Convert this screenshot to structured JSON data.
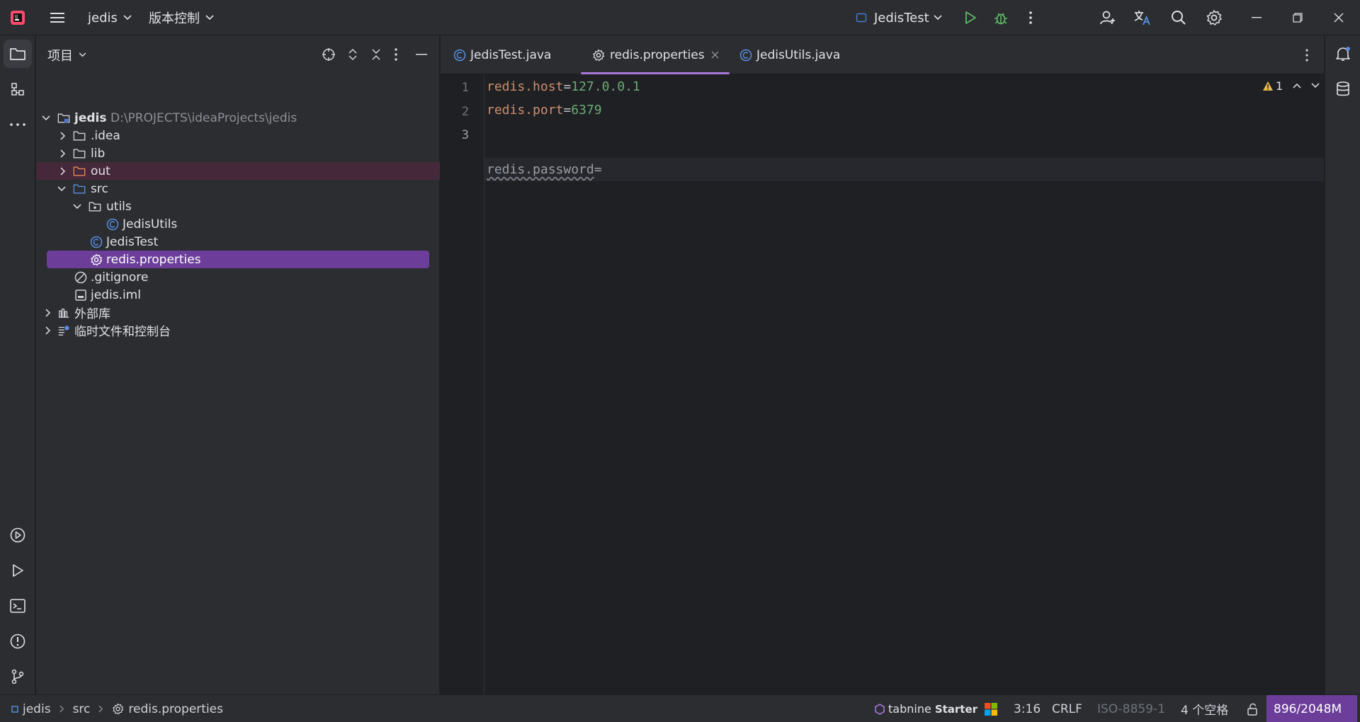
{
  "titlebar": {
    "project_name": "jedis",
    "vcs_menu": "版本控制",
    "run_config": "JedisTest"
  },
  "project_panel": {
    "title": "项目",
    "root": {
      "name": "jedis",
      "path": "D:\\PROJECTS\\ideaProjects\\jedis"
    },
    "items": [
      {
        "label": ".idea"
      },
      {
        "label": "lib"
      },
      {
        "label": "out"
      },
      {
        "label": "src"
      },
      {
        "label": "utils"
      },
      {
        "label": "JedisUtils"
      },
      {
        "label": "JedisTest"
      },
      {
        "label": "redis.properties"
      },
      {
        "label": ".gitignore"
      },
      {
        "label": "jedis.iml"
      },
      {
        "label": "外部库"
      },
      {
        "label": "临时文件和控制台"
      }
    ]
  },
  "editor": {
    "tabs": [
      {
        "label": "JedisTest.java"
      },
      {
        "label": "redis.properties"
      },
      {
        "label": "JedisUtils.java"
      }
    ],
    "warning_count": "1",
    "line_numbers": [
      "1",
      "2",
      "3"
    ],
    "lines": [
      {
        "key": "redis.host",
        "eq": "=",
        "value": "127.0.0.1"
      },
      {
        "key": "redis.port",
        "eq": "=",
        "value": "6379"
      },
      {
        "key": "redis.password",
        "eq": "=",
        "value": ""
      }
    ]
  },
  "statusbar": {
    "breadcrumb": [
      "jedis",
      "src",
      "redis.properties"
    ],
    "tabnine_brand": "tabnine",
    "tabnine_plan": "Starter",
    "caret": "3:16",
    "line_sep": "CRLF",
    "encoding": "ISO-8859-1",
    "indent": "4 个空格",
    "memory": "896/2048M"
  },
  "colors": {
    "accent": "#a777d9",
    "selected_row": "#6c3e9a",
    "excluded_row": "#45283a",
    "key": "#cf8e6d",
    "value": "#6aab73",
    "run_green": "#5fb865"
  }
}
